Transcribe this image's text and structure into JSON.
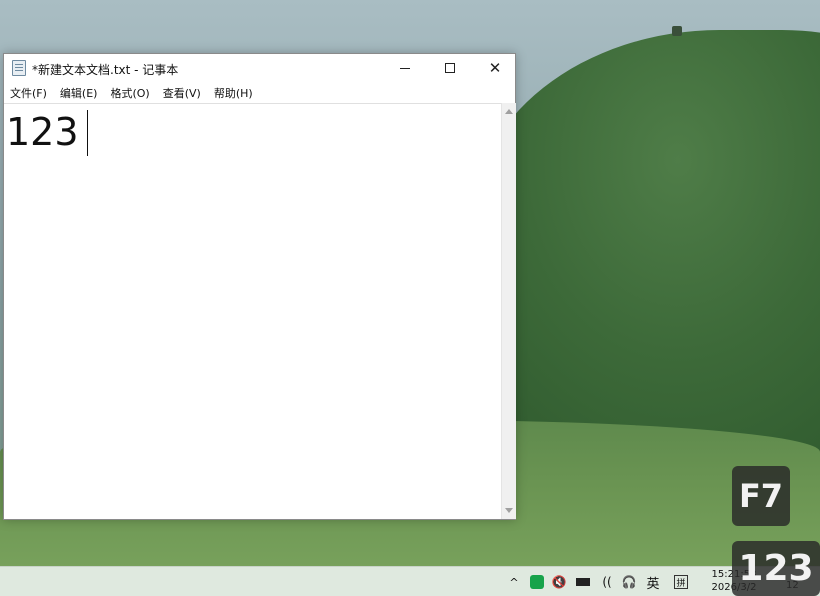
{
  "window": {
    "title": "*新建文本文档.txt - 记事本",
    "menu": [
      "文件(F)",
      "编辑(E)",
      "格式(O)",
      "查看(V)",
      "帮助(H)"
    ],
    "document_text": "123"
  },
  "overlays": {
    "key_f7": "F7",
    "key_123": "123"
  },
  "taskbar": {
    "chevron": "^",
    "volume": "🔇",
    "wifi": "((",
    "headset": "🎧",
    "lang": "英",
    "ime": "拼",
    "time": "15:21:53",
    "date": "2026/3/2",
    "notification_count": "12"
  }
}
